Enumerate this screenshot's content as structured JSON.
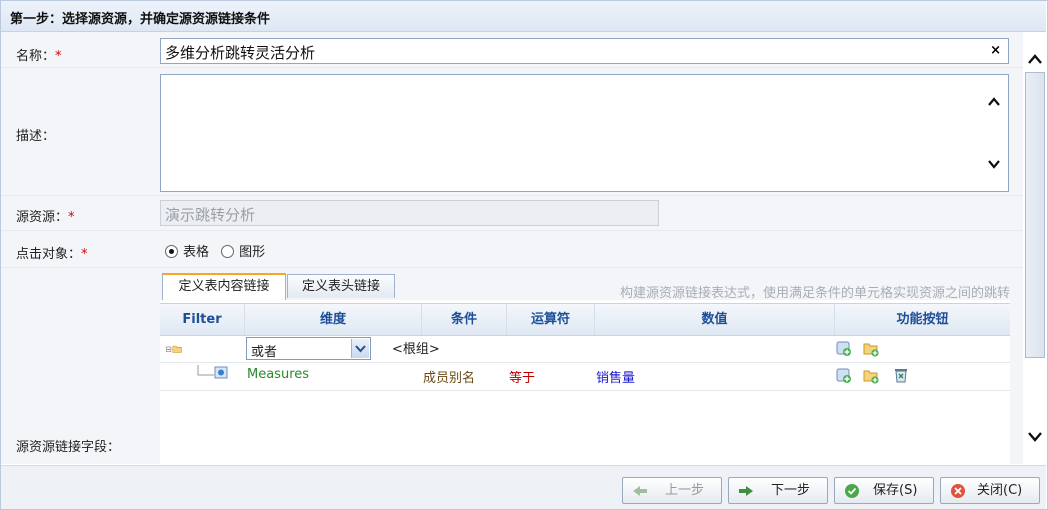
{
  "header": {
    "title": "第一步：选择源资源，并确定源资源链接条件"
  },
  "form": {
    "name": {
      "label": "名称：",
      "required": "*",
      "value": "多维分析跳转灵活分析",
      "clear": "×"
    },
    "description": {
      "label": "描述：",
      "value": ""
    },
    "source": {
      "label": "源资源：",
      "required": "*",
      "value": "演示跳转分析"
    },
    "click_target": {
      "label": "点击对象：",
      "required": "*",
      "options": [
        "表格",
        "图形"
      ],
      "selected": "表格"
    },
    "link_field": {
      "label": "源资源链接字段："
    }
  },
  "tabs": [
    {
      "label": "定义表内容链接",
      "active": true
    },
    {
      "label": "定义表头链接",
      "active": false
    }
  ],
  "hint": "构建源资源链接表达式，使用满足条件的单元格实现资源之间的跳转",
  "grid": {
    "columns": [
      "Filter",
      "维度",
      "条件",
      "运算符",
      "数值",
      "功能按钮"
    ],
    "group_row": {
      "operator_select": "或者",
      "label": "<根组>"
    },
    "rows": [
      {
        "dimension": "Measures",
        "condition": "成员别名",
        "operator": "等于",
        "value": "销售量"
      }
    ]
  },
  "footer": {
    "prev": "上一步",
    "next": "下一步",
    "save": "保存(S)",
    "close": "关闭(C)"
  },
  "colors": {
    "accent": "#1d4f99",
    "required": "#d40000",
    "dimension": "#2a8a2a",
    "operator": "#c00000",
    "value": "#1a1ad0",
    "tab_highlight": "#f5a623"
  },
  "icons": [
    "clear-icon",
    "scroll-up-icon",
    "scroll-down-icon",
    "folder-icon",
    "tree-node-icon",
    "select-arrow-icon",
    "add-condition-icon",
    "add-group-icon",
    "delete-icon",
    "prev-arrow-icon",
    "next-arrow-icon",
    "save-check-icon",
    "close-x-icon"
  ]
}
